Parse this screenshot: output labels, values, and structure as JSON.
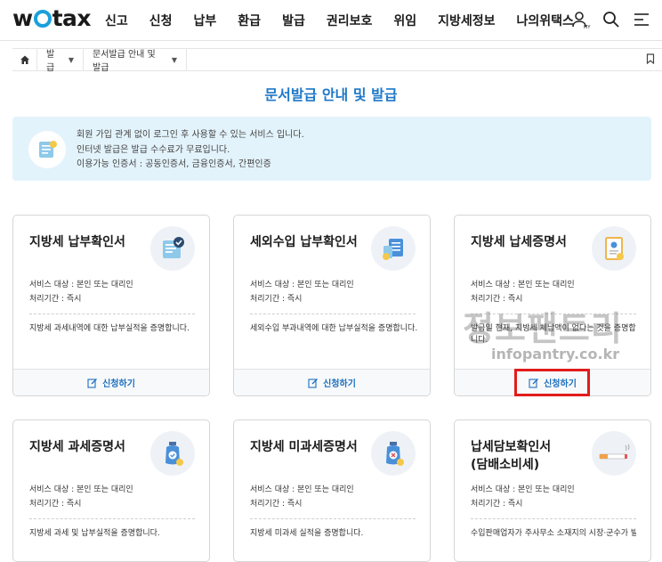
{
  "header": {
    "logo": "wetax",
    "nav": [
      "신고",
      "신청",
      "납부",
      "환급",
      "발급",
      "권리보호",
      "위임",
      "지방세정보",
      "나의위택스"
    ],
    "icons": [
      "user-icon",
      "search-icon",
      "menu-icon"
    ],
    "user_icon_label": "MY"
  },
  "breadcrumb": {
    "items": [
      "발급",
      "문서발급 안내 및 발급"
    ]
  },
  "page_title": "문서발급 안내 및 발급",
  "notice": {
    "lines": [
      "회원 가입 관계 없이 로그인 후 사용할 수 있는 서비스 입니다.",
      "인터넷 발급은 발급 수수료가 무료입니다.",
      "이용가능 인증서 : 공동인증서, 금융인증서, 간편인증"
    ]
  },
  "cards": [
    {
      "title": "지방세 납부확인서",
      "target": "서비스 대상 : 본인 또는 대리인",
      "period": "처리기간 : 즉시",
      "desc": "지방세 과세내역에 대한 납부실적을 증명합니다.",
      "button": "신청하기",
      "icon": "document-check-icon"
    },
    {
      "title": "세외수입 납부확인서",
      "target": "서비스 대상 : 본인 또는 대리인",
      "period": "처리기간 : 즉시",
      "desc": "세외수입 부과내역에 대한 납부실적을 증명합니다.",
      "button": "신청하기",
      "icon": "documents-icon"
    },
    {
      "title": "지방세 납세증명서",
      "target": "서비스 대상 : 본인 또는 대리인",
      "period": "처리기간 : 즉시",
      "desc": "발급일 현재, 지방세 체납액이 없다는 것을 증명합니다.",
      "button": "신청하기",
      "icon": "certificate-icon"
    },
    {
      "title": "지방세 과세증명서",
      "target": "서비스 대상 : 본인 또는 대리인",
      "period": "처리기간 : 즉시",
      "desc": "지방세 과세 및 납부실적을 증명합니다.",
      "icon": "bottle-check-icon"
    },
    {
      "title": "지방세 미과세증명서",
      "target": "서비스 대상 : 본인 또는 대리인",
      "period": "처리기간 : 즉시",
      "desc": "지방세 미과세 실적을 증명합니다.",
      "icon": "bottle-x-icon"
    },
    {
      "title": "납세담보확인서\n(담배소비세)",
      "target": "서비스 대상 : 본인 또는 대리인",
      "period": "처리기간 : 즉시",
      "desc": "수입판매업자가 주사무소 소재지의 시장·군수가 발",
      "icon": "cigarette-icon"
    }
  ],
  "watermark": {
    "big": "정보팬트리",
    "small": "infopantry.co.kr"
  },
  "colors": {
    "accent": "#1e78c8",
    "notice_bg": "#e3f3fb",
    "highlight": "#e21c1c"
  }
}
